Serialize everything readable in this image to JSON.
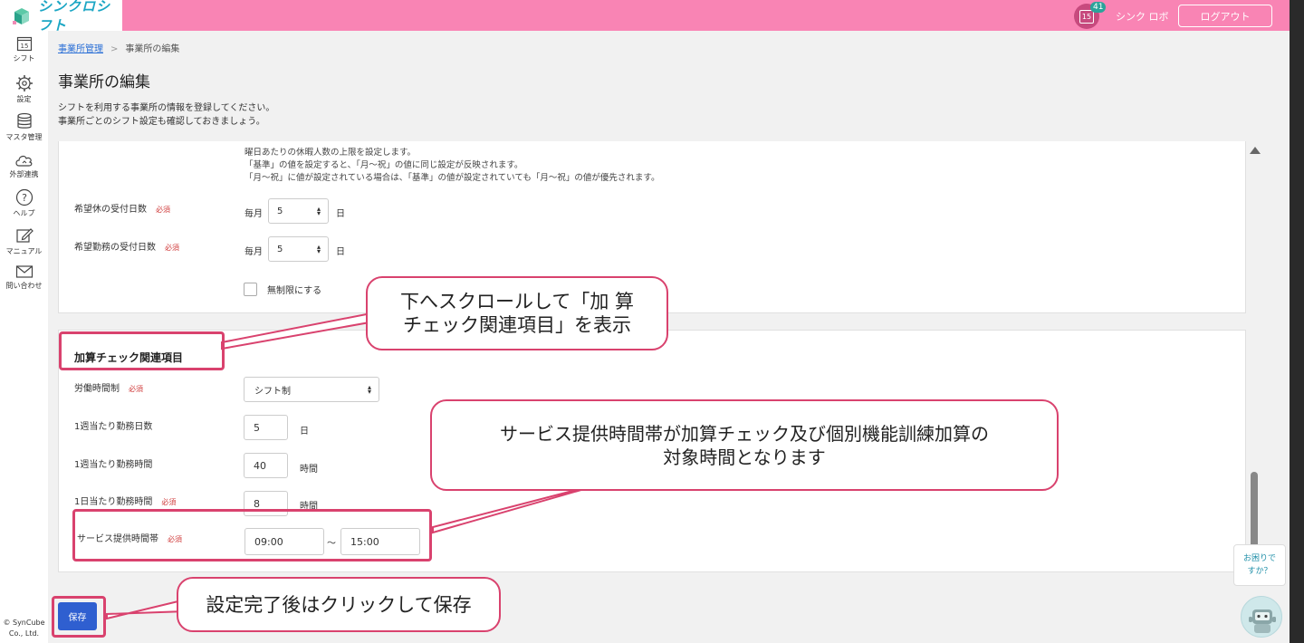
{
  "header": {
    "app_name": "シンクロシフト",
    "notification_count": "41",
    "calendar_day": "15",
    "user_name": "シンク ロボ",
    "logout_label": "ログアウト"
  },
  "sidebar": {
    "items": [
      {
        "label": "シフト",
        "icon": "calendar-icon",
        "day": "15"
      },
      {
        "label": "設定",
        "icon": "gear-icon"
      },
      {
        "label": "マスタ管理",
        "icon": "database-icon"
      },
      {
        "label": "外部連携",
        "icon": "cloud-icon"
      },
      {
        "label": "ヘルプ",
        "icon": "help-icon"
      },
      {
        "label": "マニュアル",
        "icon": "edit-icon"
      },
      {
        "label": "問い合わせ",
        "icon": "mail-icon"
      }
    ],
    "copyright_line1": "© SynCube",
    "copyright_line2": "Co., Ltd."
  },
  "breadcrumb": {
    "parent": "事業所管理",
    "separator": ">",
    "current": "事業所の編集"
  },
  "page": {
    "title": "事業所の編集",
    "desc_line1": "シフトを利用する事業所の情報を登録してください。",
    "desc_line2": "事業所ごとのシフト設定も確認しておきましょう。"
  },
  "panel1": {
    "note_line1": "曜日あたりの休暇人数の上限を設定します。",
    "note_line2": "「基準」の値を設定すると、「月〜祝」の値に同じ設定が反映されます。",
    "note_line3": "「月〜祝」に値が設定されている場合は、「基準」の値が設定されていても「月〜祝」の値が優先されます。",
    "rows": [
      {
        "label": "希望休の受付日数",
        "required": "必須",
        "prefix": "毎月",
        "value": "5",
        "suffix": "日"
      },
      {
        "label": "希望勤務の受付日数",
        "required": "必須",
        "prefix": "毎月",
        "value": "5",
        "suffix": "日"
      }
    ],
    "unlimited_label": "無制限にする"
  },
  "panel2": {
    "section_title": "加算チェック関連項目",
    "work_system": {
      "label": "労働時間制",
      "required": "必須",
      "value": "シフト制"
    },
    "days_per_week": {
      "label": "1週当たり勤務日数",
      "value": "5",
      "unit": "日"
    },
    "hours_per_week": {
      "label": "1週当たり勤務時間",
      "value": "40",
      "unit": "時間"
    },
    "hours_per_day": {
      "label": "1日当たり勤務時間",
      "required": "必須",
      "value": "8",
      "unit": "時間"
    },
    "service_hours": {
      "label": "サービス提供時間帯",
      "required": "必須",
      "start": "09:00",
      "tilde": "〜",
      "end": "15:00"
    }
  },
  "save_label": "保存",
  "help": {
    "bubble_line1": "お困りで",
    "bubble_line2": "すか？"
  },
  "callouts": {
    "scroll_line1": "下へスクロールして「加 算",
    "scroll_line2": "チェック関連項目」を表示",
    "service_line1": "サービス提供時間帯が加算チェック及び個別機能訓練加算の",
    "service_line2": "対象時間となります",
    "save_line1": "設定完了後はクリックして保存"
  },
  "colors": {
    "header_bg": "#f984b4",
    "accent_blue": "#2f5fd0",
    "annotation": "#d9426e"
  }
}
